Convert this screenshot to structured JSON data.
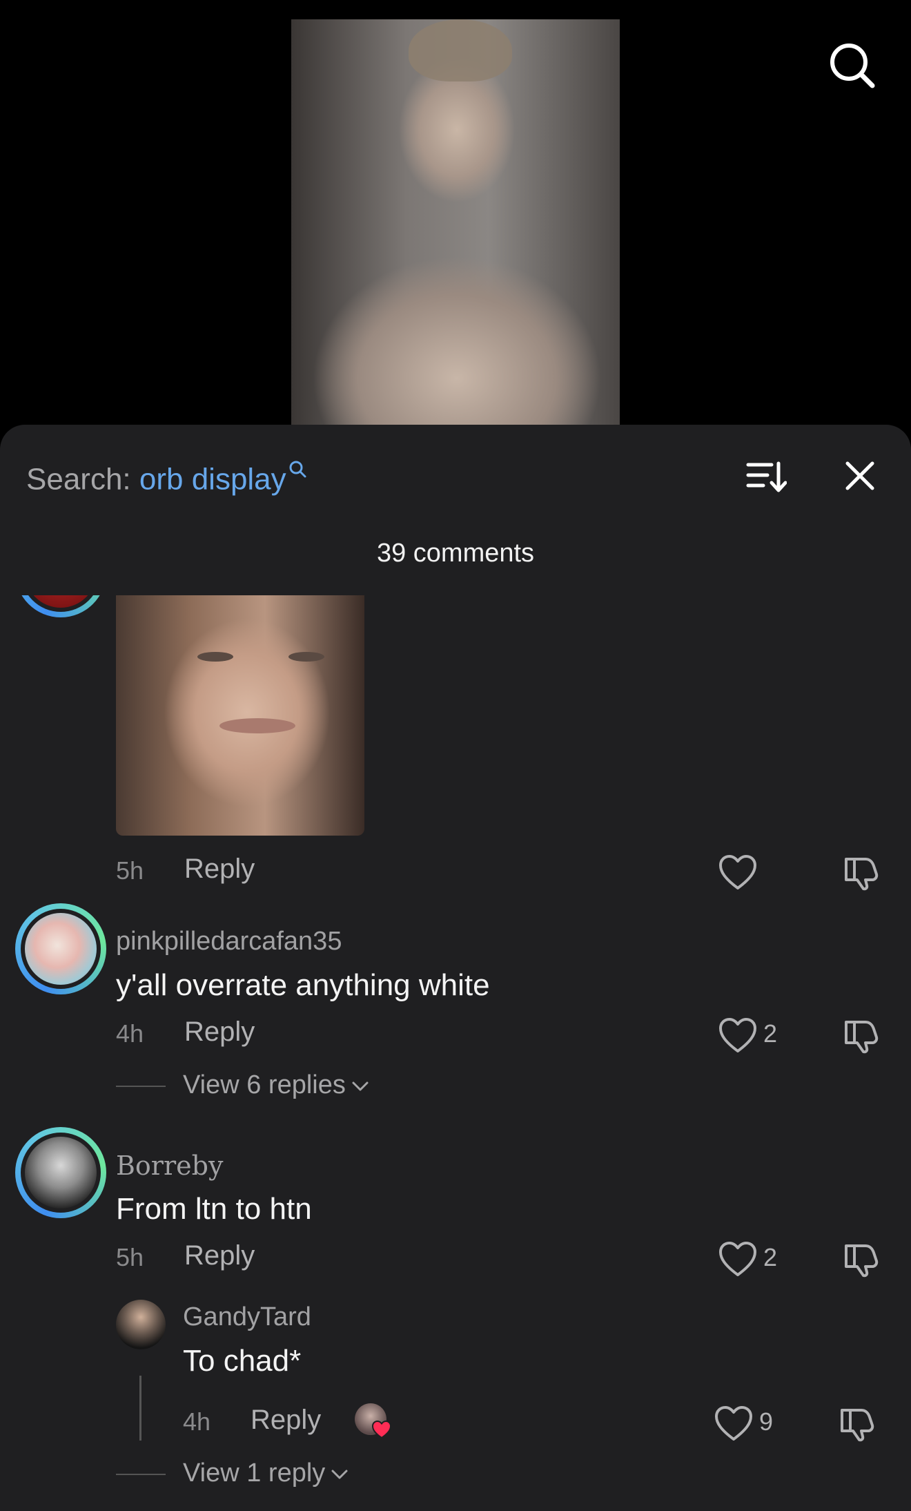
{
  "header": {
    "search_prefix": "Search:",
    "search_term": "orb display",
    "comment_count": "39 comments"
  },
  "icons": {
    "top_search": "search-icon",
    "sort": "sort-icon",
    "close": "close-icon"
  },
  "colors": {
    "sheet_bg": "#1f1f21",
    "accent_blue": "#67a7ea",
    "ring_gradient": [
      "#3f8ef0",
      "#6ee79d"
    ],
    "like_red": "#ff2d55"
  },
  "comments": [
    {
      "time": "5h",
      "reply_label": "Reply",
      "likes": ""
    },
    {
      "username": "pinkpilledarcafan35",
      "text": "y'all overrate anything white",
      "time": "4h",
      "reply_label": "Reply",
      "likes": "2",
      "view_replies": "View 6 replies"
    },
    {
      "username": "Borreby",
      "text": "From ltn to htn",
      "time": "5h",
      "reply_label": "Reply",
      "likes": "2",
      "replies": [
        {
          "username": "GandyTard",
          "text": "To chad*",
          "time": "4h",
          "reply_label": "Reply",
          "likes": "9"
        }
      ],
      "view_replies": "View 1 reply"
    }
  ]
}
